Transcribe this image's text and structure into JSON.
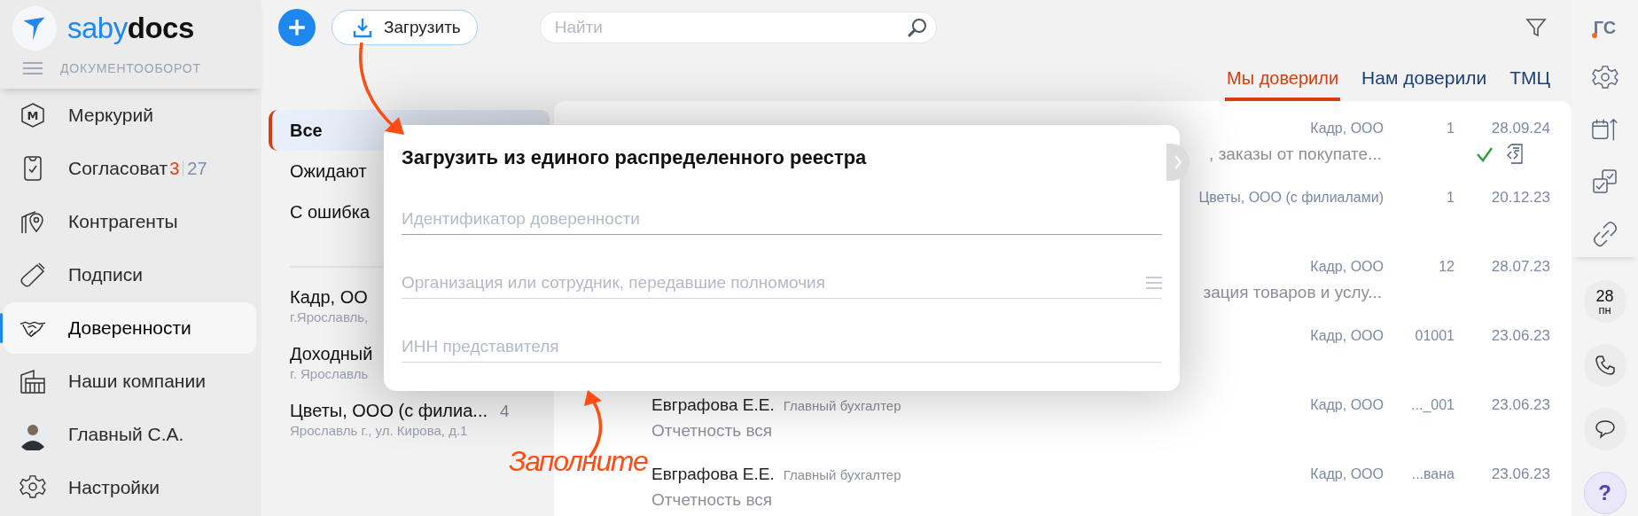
{
  "brand": {
    "part_1": "saby",
    "part_2": "docs",
    "section": "ДОКУМЕНТООБОРОТ"
  },
  "sidebar": {
    "items": [
      {
        "kind": "mercury",
        "label": "Меркурий",
        "icon_text": "М",
        "selected": false
      },
      {
        "kind": "approve",
        "label": "Согласоват",
        "counter_new": "3",
        "counter_total": "27",
        "selected": false
      },
      {
        "kind": "contractors",
        "label": "Контрагенты",
        "selected": false
      },
      {
        "kind": "signatures",
        "label": "Подписи",
        "selected": false
      },
      {
        "kind": "handshake",
        "label": "Доверенности",
        "selected": true
      },
      {
        "kind": "companies",
        "label": "Наши компании",
        "selected": false
      },
      {
        "kind": "avatar",
        "label": "Главный С.А.",
        "selected": false
      },
      {
        "kind": "settings",
        "label": "Настройки",
        "selected": false
      }
    ]
  },
  "toolbar": {
    "upload_label": "Загрузить",
    "search": {
      "placeholder": "Найти"
    }
  },
  "tabs": [
    {
      "label": "Мы доверили",
      "selected": true
    },
    {
      "label": "Нам доверили",
      "selected": false
    },
    {
      "label": "ТМЦ",
      "selected": false
    }
  ],
  "filters": [
    {
      "label": "Все",
      "selected": true
    },
    {
      "label": "Ожидают",
      "selected": false
    },
    {
      "label": "С ошибка",
      "selected": false
    }
  ],
  "organizations": [
    {
      "name": "Кадр, ОО",
      "address": "г.Ярославль,"
    },
    {
      "name": "Доходный",
      "address": "г. Ярославль"
    },
    {
      "name": "Цветы, ООО (с филиа...",
      "count": "4",
      "address": "Ярославль г., ул. Кирова, д.1"
    }
  ],
  "rows": [
    {
      "org": "Кадр, ООО",
      "number": "1",
      "date": "28.09.24",
      "description": ", заказы от покупате...",
      "approved": true
    },
    {
      "org": "Цветы, ООО (с филиалами)",
      "number": "1",
      "date": "20.12.23",
      "approved": false
    },
    {
      "org": "Кадр, ООО",
      "number": "12",
      "date": "28.07.23",
      "description": "зация товаров и услу...",
      "approved": false
    },
    {
      "org": "Кадр, ООО",
      "number": "01001",
      "date": "23.06.23",
      "approved": false
    },
    {
      "person": "Евграфова Е.Е.",
      "position": "Главный бухгалтер",
      "description": "Отчетность вся",
      "org": "Кадр, ООО",
      "number": "..._001",
      "date": "23.06.23",
      "approved": false
    },
    {
      "person": "Евграфова Е.Е.",
      "position": "Главный бухгалтер",
      "description": "Отчетность вся",
      "org": "Кадр, ООО",
      "number": "...вана",
      "date": "23.06.23",
      "approved": false
    }
  ],
  "dialog": {
    "title": "Загрузить из единого распределенного реестра",
    "fields": [
      {
        "kind": "text",
        "placeholder": "Идентификатор доверенности"
      },
      {
        "kind": "list",
        "placeholder": "Организация или сотрудник, передавшие полномочия"
      },
      {
        "kind": "text",
        "placeholder": "ИНН представителя"
      }
    ]
  },
  "annotation": {
    "text": "Заполните"
  },
  "rail": {
    "initials": "ГС",
    "notification": true,
    "tools": [
      {
        "kind": "settings"
      },
      {
        "kind": "calendar"
      },
      {
        "kind": "tasks"
      },
      {
        "kind": "link"
      }
    ],
    "day": "28",
    "weekday": "пн",
    "contacts": [
      {
        "kind": "phone"
      },
      {
        "kind": "chat"
      }
    ],
    "help": "?"
  }
}
